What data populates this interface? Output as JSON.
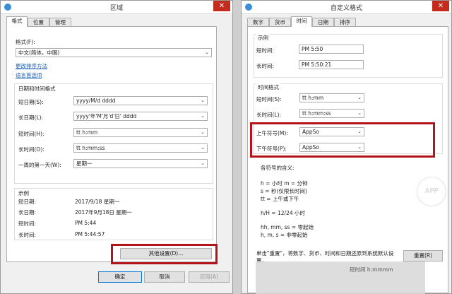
{
  "left": {
    "title": "区域",
    "tabs": [
      "格式",
      "位置",
      "管理"
    ],
    "format_label": "格式(F):",
    "format_value": "中文(简体，中国)",
    "link_sort": "更改排序方法",
    "link_lang": "语言首选项",
    "datetime_group": "日期和时间格式",
    "rows": [
      {
        "label": "短日期(S):",
        "value": "yyyy/M/d dddd"
      },
      {
        "label": "长日期(L):",
        "value": "yyyy'年'M'月'd'日' dddd"
      },
      {
        "label": "短时间(H):",
        "value": "tt h:mm"
      },
      {
        "label": "长时间(O):",
        "value": "tt h:mm:ss"
      },
      {
        "label": "一周的第一天(W):",
        "value": "星期一"
      }
    ],
    "example_group": "示例",
    "examples": [
      {
        "label": "短日期:",
        "value": "2017/9/18 星期一"
      },
      {
        "label": "长日期:",
        "value": "2017年9月18日 星期一"
      },
      {
        "label": "短时间:",
        "value": "PM 5:44"
      },
      {
        "label": "长时间:",
        "value": "PM 5:44:57"
      }
    ],
    "other_settings": "其他设置(D)...",
    "ok": "确定",
    "cancel": "取消",
    "apply": "应用(A)"
  },
  "right": {
    "title": "自定义格式",
    "tabs": [
      "数字",
      "货币",
      "时间",
      "日期",
      "排序"
    ],
    "example_group": "示例",
    "example_short_label": "短时间:",
    "example_short_value": "PM 5:50",
    "example_long_label": "长时间:",
    "example_long_value": "PM 5:50:21",
    "time_group": "时间格式",
    "short_time_label": "短时间(S):",
    "short_time_value": "tt h:mm",
    "long_time_label": "长时间(L):",
    "long_time_value": "tt h:mm:ss",
    "am_label": "上午符号(M):",
    "am_value": "AppSo",
    "pm_label": "下午符号(P):",
    "pm_value": "AppSo",
    "meaning_title": "各符号的含义:",
    "meaning_lines": [
      "h = 小时    m = 分钟",
      "s = 秒(仅限长时间)",
      "tt = 上午或下午",
      "h/H = 12/24 小时",
      "hh, mm, ss = 零起始",
      "h, m, s = 非零起始"
    ],
    "reset_note": "单击\"重置\"，将数字、货币、时间和日期还原到系统默认设置。",
    "reset": "重置(R)",
    "bottom_partial": "短时间 h:mmmm"
  },
  "watermark": "APP"
}
